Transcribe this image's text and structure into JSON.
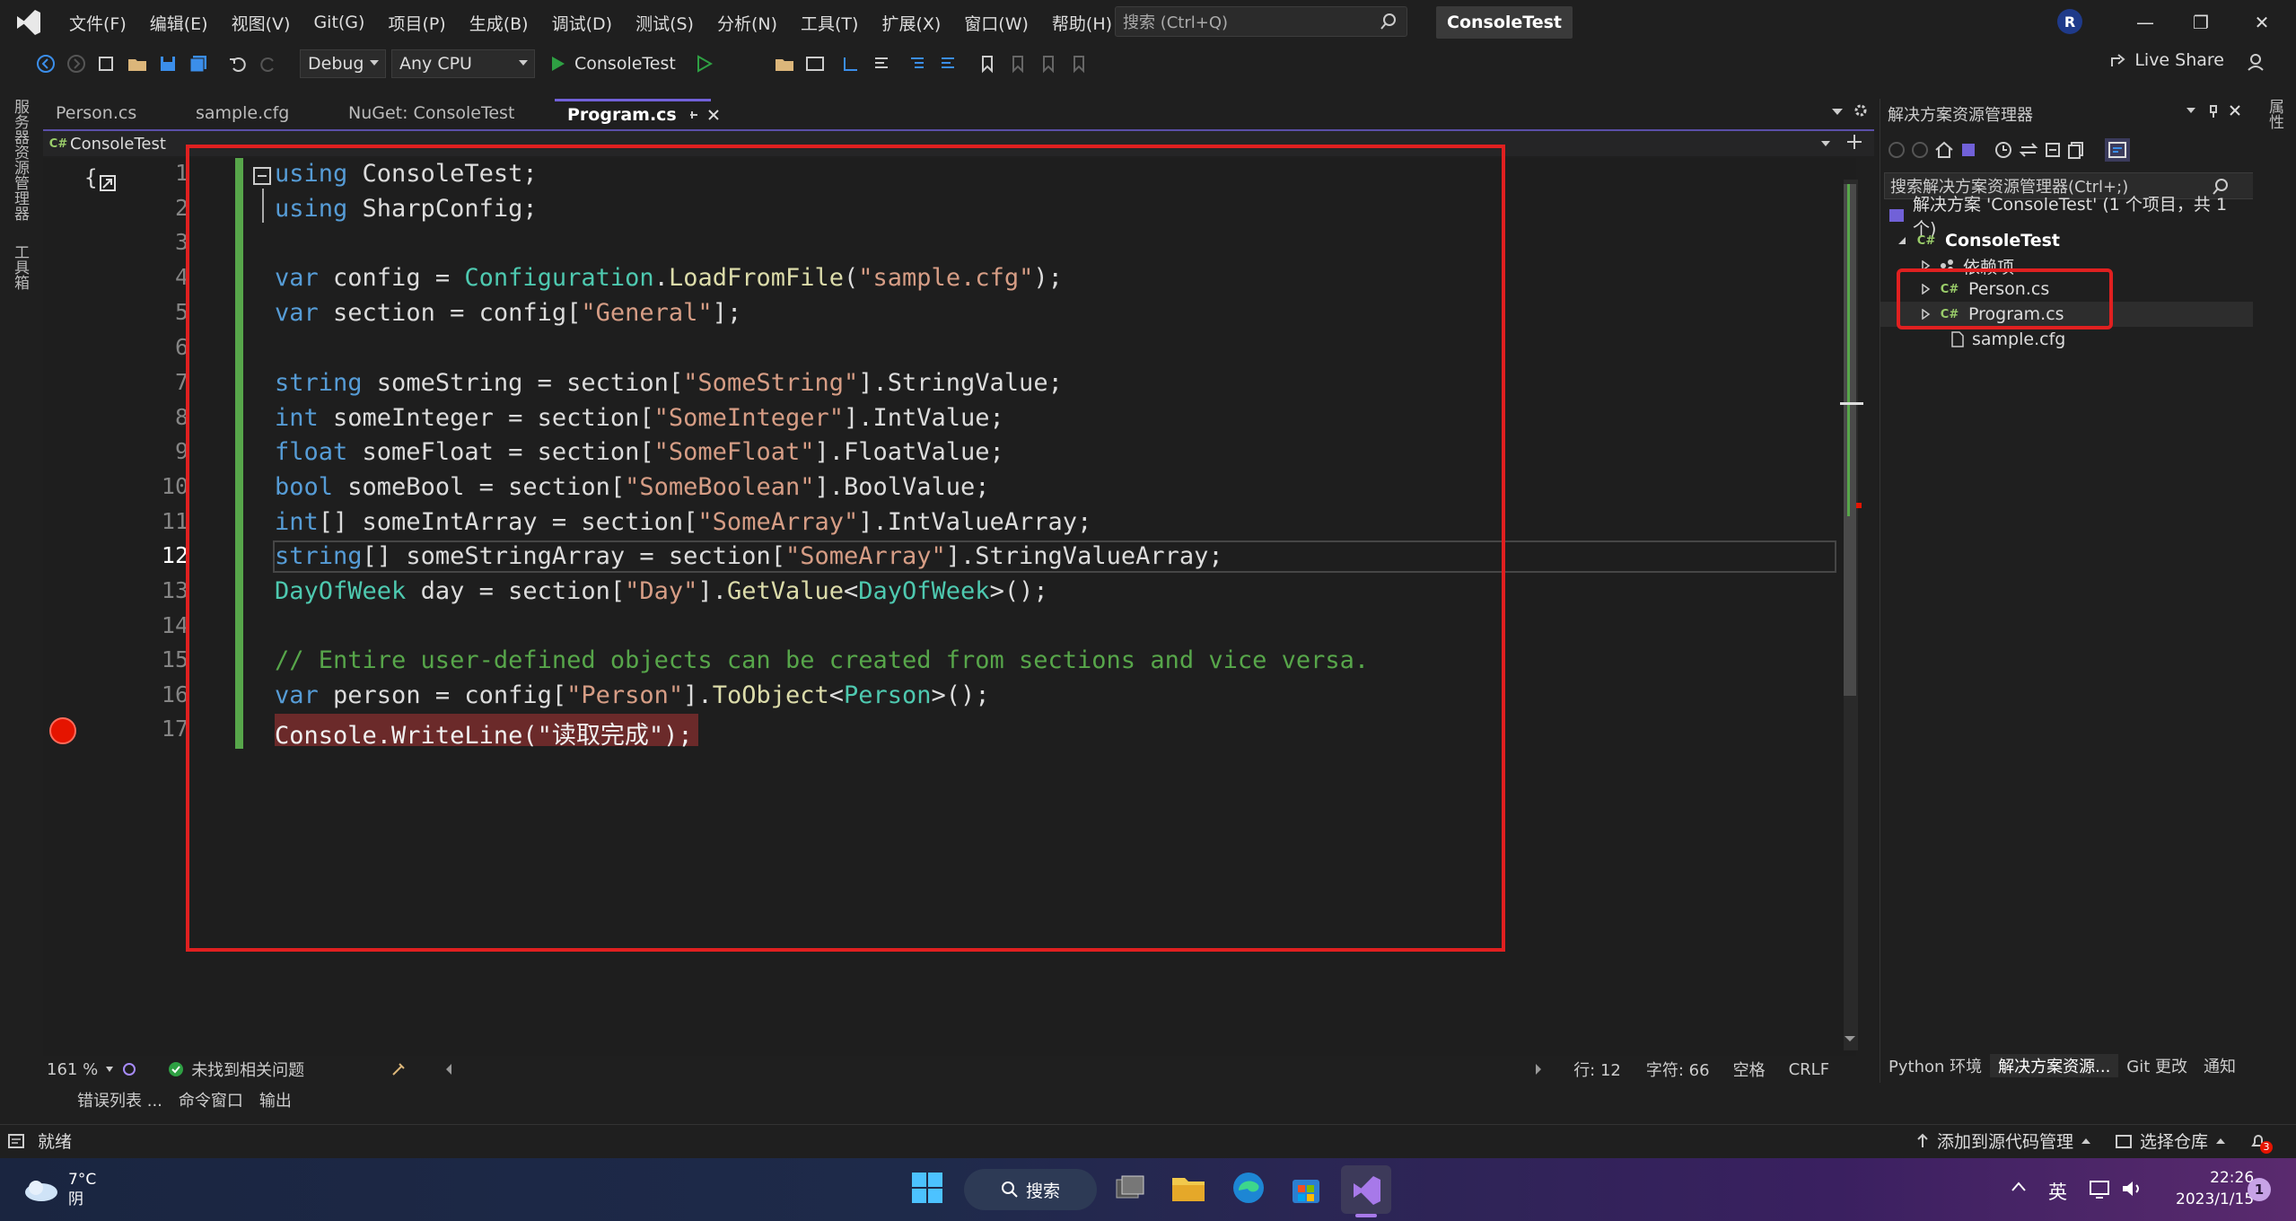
{
  "menu": {
    "items": [
      "文件(F)",
      "编辑(E)",
      "视图(V)",
      "Git(G)",
      "项目(P)",
      "生成(B)",
      "调试(D)",
      "测试(S)",
      "分析(N)",
      "工具(T)",
      "扩展(X)",
      "窗口(W)",
      "帮助(H)"
    ],
    "search_placeholder": "搜索 (Ctrl+Q)",
    "project_title": "ConsoleTest",
    "avatar_letter": "R"
  },
  "toolbar": {
    "config": "Debug",
    "platform": "Any CPU",
    "run_target": "ConsoleTest",
    "live_share": "Live Share"
  },
  "left_vertical_tabs": [
    "服务器资源管理器",
    "工具箱"
  ],
  "right_vertical_tabs": [
    "属性"
  ],
  "tabs": [
    {
      "label": "Person.cs",
      "active": false
    },
    {
      "label": "sample.cfg",
      "active": false
    },
    {
      "label": "NuGet: ConsoleTest",
      "active": false
    },
    {
      "label": "Program.cs",
      "active": true
    }
  ],
  "nav": {
    "project": "ConsoleTest"
  },
  "editor": {
    "line_numbers": [
      "1",
      "2",
      "3",
      "4",
      "5",
      "6",
      "7",
      "8",
      "9",
      "10",
      "11",
      "12",
      "13",
      "14",
      "15",
      "16",
      "17"
    ],
    "current_line": 12,
    "breakpoint_line": 17
  },
  "status_row": {
    "zoom": "161 %",
    "issues": "未找到相关问题",
    "line": "行: 12",
    "char": "字符: 66",
    "space": "空格",
    "eol": "CRLF"
  },
  "bottom_tabs": [
    "错误列表 ...",
    "命令窗口",
    "输出"
  ],
  "statusbar": {
    "ready": "就绪",
    "add_source": "添加到源代码管理",
    "select_repo": "选择仓库",
    "notif_count": "3"
  },
  "solution_explorer": {
    "title": "解决方案资源管理器",
    "search": "搜索解决方案资源管理器(Ctrl+;)",
    "solution": "解决方案 'ConsoleTest' (1 个项目，共 1 个)",
    "project": "ConsoleTest",
    "deps": "依赖项",
    "files": [
      "Person.cs",
      "Program.cs",
      "sample.cfg"
    ],
    "bottom_tabs": [
      "Python 环境",
      "解决方案资源...",
      "Git 更改",
      "通知"
    ]
  },
  "taskbar": {
    "weather_temp": "7°C",
    "weather_desc": "阴",
    "search": "搜索",
    "ime": "英",
    "time": "22:26",
    "date": "2023/1/15",
    "badge": "1"
  },
  "colors": {
    "accent": "#7161d8",
    "green_bar": "#57a64a",
    "breakpoint": "#e51400",
    "highlight_box": "#e02020"
  }
}
